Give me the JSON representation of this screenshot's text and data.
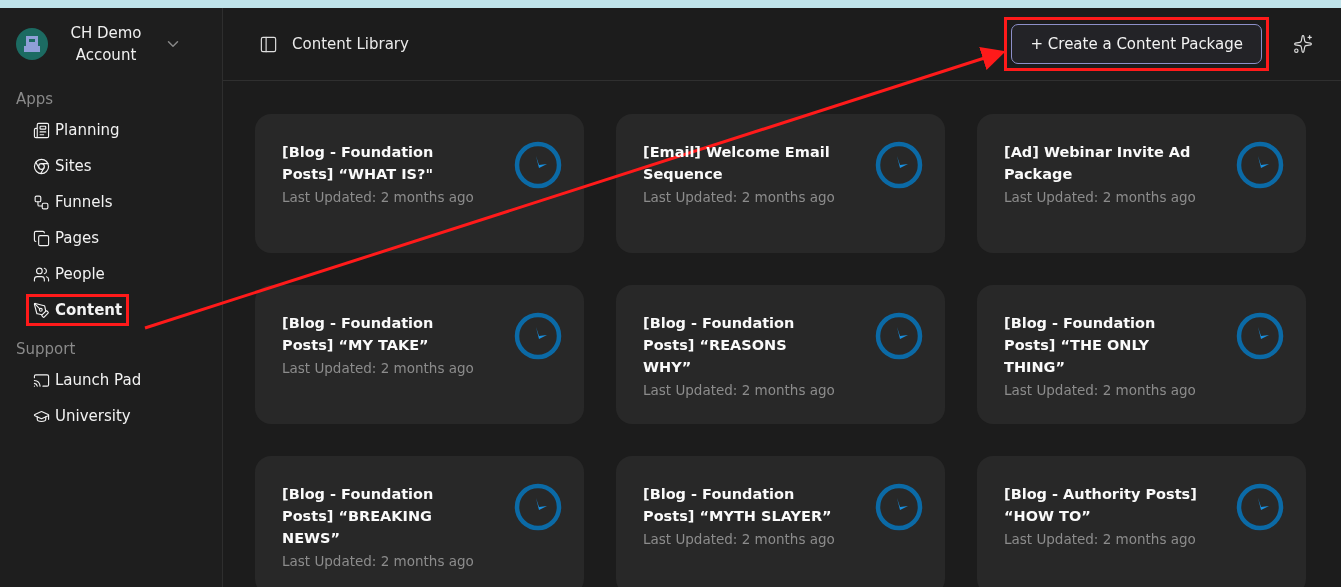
{
  "account": {
    "name": "CH Demo Account"
  },
  "sidebar": {
    "sections": [
      {
        "title": "Apps",
        "items": [
          {
            "label": "Planning",
            "selected": false,
            "highlighted": false
          },
          {
            "label": "Sites",
            "selected": false,
            "highlighted": false
          },
          {
            "label": "Funnels",
            "selected": false,
            "highlighted": false
          },
          {
            "label": "Pages",
            "selected": false,
            "highlighted": false
          },
          {
            "label": "People",
            "selected": false,
            "highlighted": false
          },
          {
            "label": "Content",
            "selected": true,
            "highlighted": true
          }
        ]
      },
      {
        "title": "Support",
        "items": [
          {
            "label": "Launch Pad",
            "selected": false,
            "highlighted": false
          },
          {
            "label": "University",
            "selected": false,
            "highlighted": false
          }
        ]
      }
    ]
  },
  "header": {
    "title": "Content Library",
    "create_button": {
      "label": "+ Create a Content Package",
      "highlighted": true
    }
  },
  "cards": [
    {
      "title": "[Blog - Foundation Posts] “WHAT IS?\"",
      "updated": "Last Updated: 2 months ago"
    },
    {
      "title": "[Email] Welcome Email Sequence",
      "updated": "Last Updated: 2 months ago"
    },
    {
      "title": "[Ad] Webinar Invite Ad Package",
      "updated": "Last Updated: 2 months ago"
    },
    {
      "title": "[Blog - Foundation Posts] “MY TAKE”",
      "updated": "Last Updated: 2 months ago"
    },
    {
      "title": "[Blog - Foundation Posts] “REASONS WHY”",
      "updated": "Last Updated: 2 months ago"
    },
    {
      "title": "[Blog - Foundation Posts] “THE ONLY THING”",
      "updated": "Last Updated: 2 months ago"
    },
    {
      "title": "[Blog - Foundation Posts] “BREAKING NEWS”",
      "updated": "Last Updated: 2 months ago"
    },
    {
      "title": "[Blog - Foundation Posts] “MYTH SLAYER”",
      "updated": "Last Updated: 2 months ago"
    },
    {
      "title": "[Blog - Authority Posts] “HOW TO”",
      "updated": "Last Updated: 2 months ago"
    }
  ]
}
